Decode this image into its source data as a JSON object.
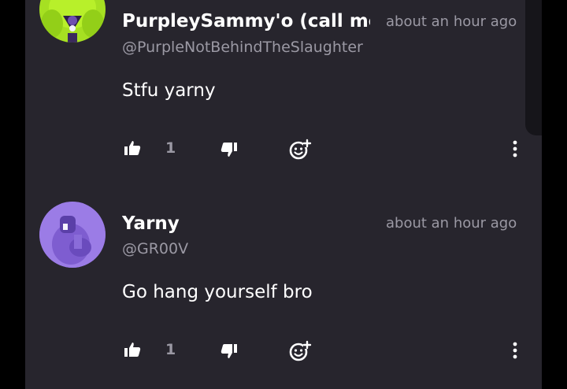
{
  "comments": [
    {
      "username": "PurpleySammy'o (call me",
      "handle": "@PurpleNotBehindTheSlaughter",
      "time": "about an hour ago",
      "text": "Stfu yarny",
      "likes": "1",
      "avatar_icon": "green-character-avatar"
    },
    {
      "username": "Yarny",
      "handle": "@GR00V",
      "time": "about an hour ago",
      "text": "Go hang yourself bro",
      "likes": "1",
      "avatar_icon": "purple-character-avatar"
    }
  ],
  "icons": {
    "like": "thumbs-up-icon",
    "dislike": "thumbs-down-icon",
    "react": "add-reaction-icon",
    "more": "more-vertical-icon"
  },
  "colors": {
    "panel_bg": "#27252d",
    "text_primary": "#ffffff",
    "text_secondary": "#9b99a4"
  }
}
